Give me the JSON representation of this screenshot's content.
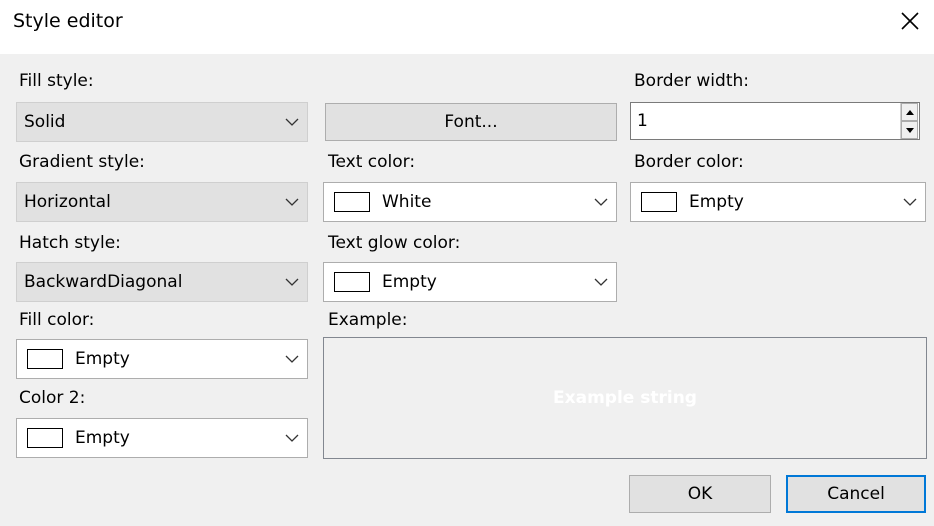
{
  "window": {
    "title": "Style editor",
    "close_icon": "close-icon"
  },
  "fill_style": {
    "label": "Fill style:",
    "value": "Solid"
  },
  "gradient_style": {
    "label": "Gradient style:",
    "value": "Horizontal"
  },
  "hatch_style": {
    "label": "Hatch style:",
    "value": "BackwardDiagonal"
  },
  "fill_color": {
    "label": "Fill color:",
    "value": "Empty",
    "swatch": "#ffffff"
  },
  "color2": {
    "label": "Color 2:",
    "value": "Empty",
    "swatch": "#ffffff"
  },
  "font_button": {
    "label": "Font..."
  },
  "text_color": {
    "label": "Text color:",
    "value": "White",
    "swatch": "#ffffff"
  },
  "text_glow_color": {
    "label": "Text glow color:",
    "value": "Empty",
    "swatch": "#ffffff"
  },
  "example": {
    "label": "Example:",
    "text": "Example string",
    "text_color": "#ffffff"
  },
  "border_width": {
    "label": "Border width:",
    "value": "1"
  },
  "border_color": {
    "label": "Border color:",
    "value": "Empty",
    "swatch": "#ffffff"
  },
  "buttons": {
    "ok": "OK",
    "cancel": "Cancel"
  },
  "colors": {
    "accent": "#0078d7",
    "dialog_bg": "#f0f0f0"
  }
}
